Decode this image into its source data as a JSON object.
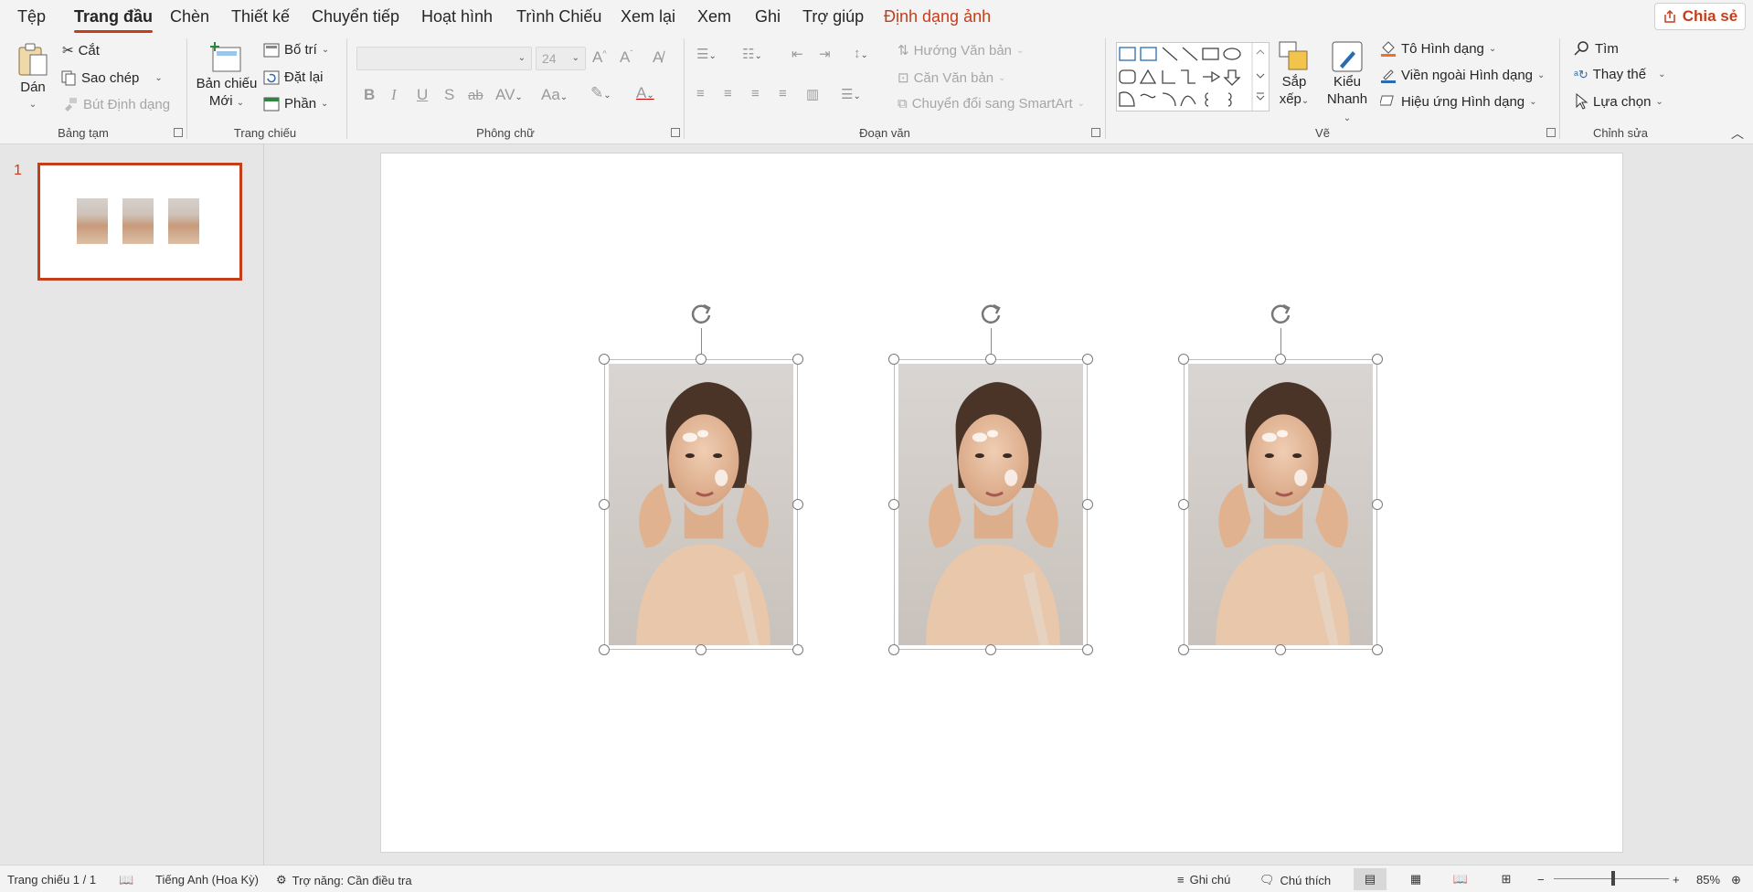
{
  "menu": {
    "tabs": [
      "Tệp",
      "Trang đầu",
      "Chèn",
      "Thiết kế",
      "Chuyển tiếp",
      "Hoạt hình",
      "Trình Chiếu",
      "Xem lại",
      "Xem",
      "Ghi",
      "Trợ giúp",
      "Định dạng ảnh"
    ],
    "active_tab": "Trang đầu",
    "share_label": "Chia sẻ"
  },
  "ribbon": {
    "clipboard": {
      "paste": "Dán",
      "cut": "Cắt",
      "copy": "Sao chép",
      "format_painter": "Bút Định dạng",
      "label": "Bảng tạm"
    },
    "slides": {
      "new_slide_line1": "Bản chiếu",
      "new_slide_line2": "Mới",
      "layout": "Bố trí",
      "reset": "Đặt lại",
      "section": "Phần",
      "label": "Trang chiếu"
    },
    "font": {
      "font_name": "",
      "font_size": "24",
      "label": "Phông chữ"
    },
    "paragraph": {
      "text_direction": "Hướng Văn bản",
      "align_text": "Căn Văn bản",
      "smartart": "Chuyển đổi sang SmartArt",
      "label": "Đoạn văn"
    },
    "drawing": {
      "arrange_line1": "Sắp",
      "arrange_line2": "xếp",
      "quick_styles_line1": "Kiểu",
      "quick_styles_line2": "Nhanh",
      "shape_fill": "Tô Hình dạng",
      "shape_outline": "Viền ngoài Hình dạng",
      "shape_effects": "Hiệu ứng Hình dạng",
      "label": "Vẽ"
    },
    "editing": {
      "find": "Tìm",
      "replace": "Thay thế",
      "select": "Lựa chọn",
      "label": "Chỉnh sửa"
    }
  },
  "thumbnails": [
    {
      "number": "1"
    }
  ],
  "status": {
    "slide_info": "Trang chiếu 1 / 1",
    "language": "Tiếng Anh (Hoa Kỳ)",
    "accessibility": "Trợ năng: Cần điều tra",
    "notes": "Ghi chú",
    "comments": "Chú thích",
    "zoom": "85%",
    "zoom_level": 0.85
  },
  "colors": {
    "accent": "#c43e1c",
    "ribbon_bg": "#f3f3f3",
    "workspace_bg": "#e6e6e6"
  }
}
